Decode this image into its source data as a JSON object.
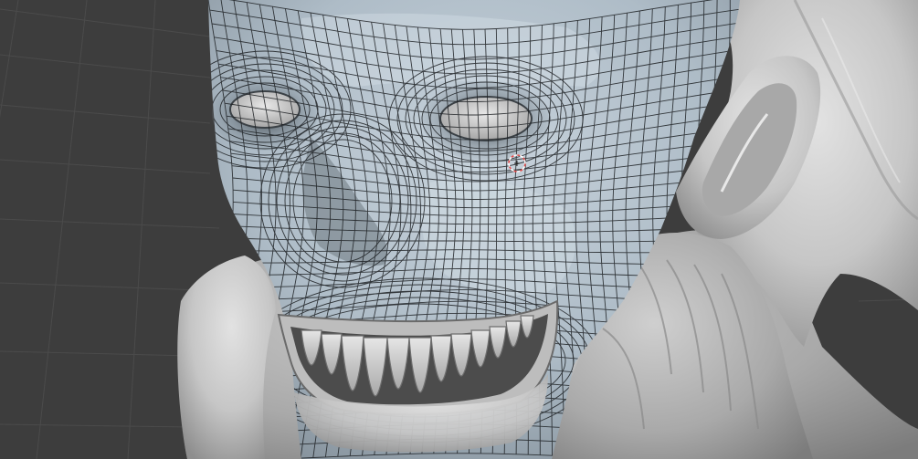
{
  "app": {
    "name": "",
    "mode": "retopology"
  },
  "viewport": {
    "background_color": "#3d3d3d",
    "grid_color": "#4a4a4a",
    "sculpt_color": "#c9c9c9",
    "retopo_surface_color": "#b3c0ca",
    "wire_color": "#1c1f22"
  },
  "scene": {
    "object": "sculpted-head",
    "retopo_overlay": "quad-wireframe",
    "cursor": "3d-cursor-icon"
  }
}
